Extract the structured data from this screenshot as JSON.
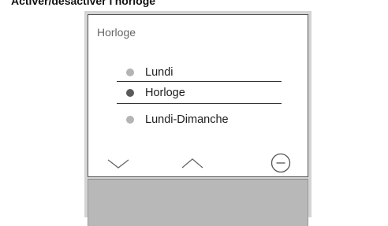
{
  "heading": "Activer/désactiver l'horloge",
  "screen": {
    "title": "Horloge",
    "menu": [
      {
        "label": "Lundi",
        "dot_color": "#b4b4b4",
        "selected": false
      },
      {
        "label": "Horloge",
        "dot_color": "#5a5a5a",
        "selected": true
      },
      {
        "label": "Lundi-Dimanche",
        "dot_color": "#b4b4b4",
        "selected": false
      }
    ]
  },
  "controls": {
    "down_icon": "chevron-down-icon",
    "up_icon": "chevron-up-icon",
    "minus_icon": "circle-minus-icon"
  },
  "colors": {
    "device_frame": "#d4d4d4",
    "bottom_panel": "#b8b8b8",
    "selected_dot": "#5a5a5a",
    "unselected_dot": "#b4b4b4"
  }
}
